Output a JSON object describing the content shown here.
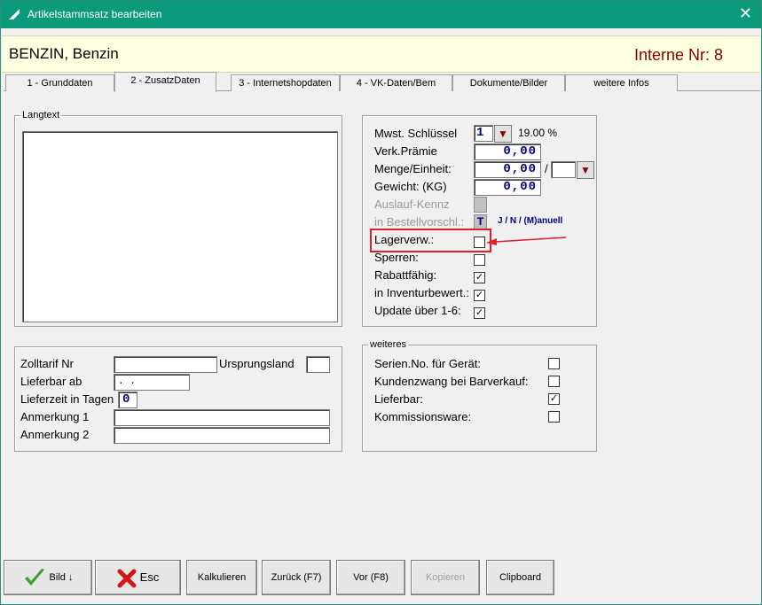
{
  "window": {
    "title": "Artikelstammsatz bearbeiten",
    "close": "✕"
  },
  "header": {
    "name": "BENZIN, Benzin",
    "interne_nr": "Interne Nr: 8"
  },
  "tabs": [
    {
      "label": "1 - Grunddaten"
    },
    {
      "label": "2 - ZusatzDaten"
    },
    {
      "label": "3 - Internetshopdaten"
    },
    {
      "label": "4 - VK-Daten/Bem"
    },
    {
      "label": "Dokumente/Bilder"
    },
    {
      "label": "weitere Infos"
    }
  ],
  "langtext": {
    "legend": "Langtext",
    "value": ""
  },
  "right_panel": {
    "mwst_label": "Mwst. Schlüssel",
    "mwst_value": "1",
    "mwst_percent": "19.00 %",
    "verk_label": "Verk.Prämie",
    "verk_value": "0,00",
    "menge_label": "Menge/Einheit:",
    "menge_value": "0,00",
    "menge_sep": "/",
    "menge_unit": "",
    "gewicht_label": "Gewicht: (KG)",
    "gewicht_value": "0,00",
    "auslauf_label": "Auslauf-Kennz",
    "bestell_label": "in Bestellvorschl.:",
    "bestell_value": "T",
    "bestell_hint": "J / N / (M)anuell",
    "lagerverw_label": "Lagerverw.:",
    "sperren_label": "Sperren:",
    "rabatt_label": "Rabattfähig:",
    "inventur_label": "in Inventurbewert.:",
    "update_label": "Update über 1-6:",
    "checks": {
      "lagerverw": "",
      "sperren": "",
      "rabatt": "✓",
      "inventur": "✓",
      "update": "✓"
    }
  },
  "left_bottom": {
    "zolltarif_label": "Zolltarif Nr",
    "zolltarif_value": "",
    "ursprung_label": "Ursprungsland",
    "ursprung_value": "",
    "lieferbar_label": "Lieferbar ab",
    "lieferbar_value": ". .",
    "lieferzeit_label": "Lieferzeit in Tagen",
    "lieferzeit_value": "0",
    "anm1_label": "Anmerkung 1",
    "anm1_value": "",
    "anm2_label": "Anmerkung 2",
    "anm2_value": ""
  },
  "weiteres": {
    "legend": "weiteres",
    "serien_label": "Serien.No. für Gerät:",
    "kunden_label": "Kundenzwang bei Barverkauf:",
    "lieferbar_label": "Lieferbar:",
    "kommission_label": "Kommissionsware:",
    "checks": {
      "serien": "",
      "kunden": "",
      "lieferbar": "✓",
      "kommission": ""
    }
  },
  "buttons": {
    "bild": "Bild",
    "esc": "Esc",
    "kalkulieren": "Kalkulieren",
    "zurueck": "Zurück (F7)",
    "vor": "Vor (F8)",
    "kopieren": "Kopieren",
    "clipboard": "Clipboard"
  }
}
